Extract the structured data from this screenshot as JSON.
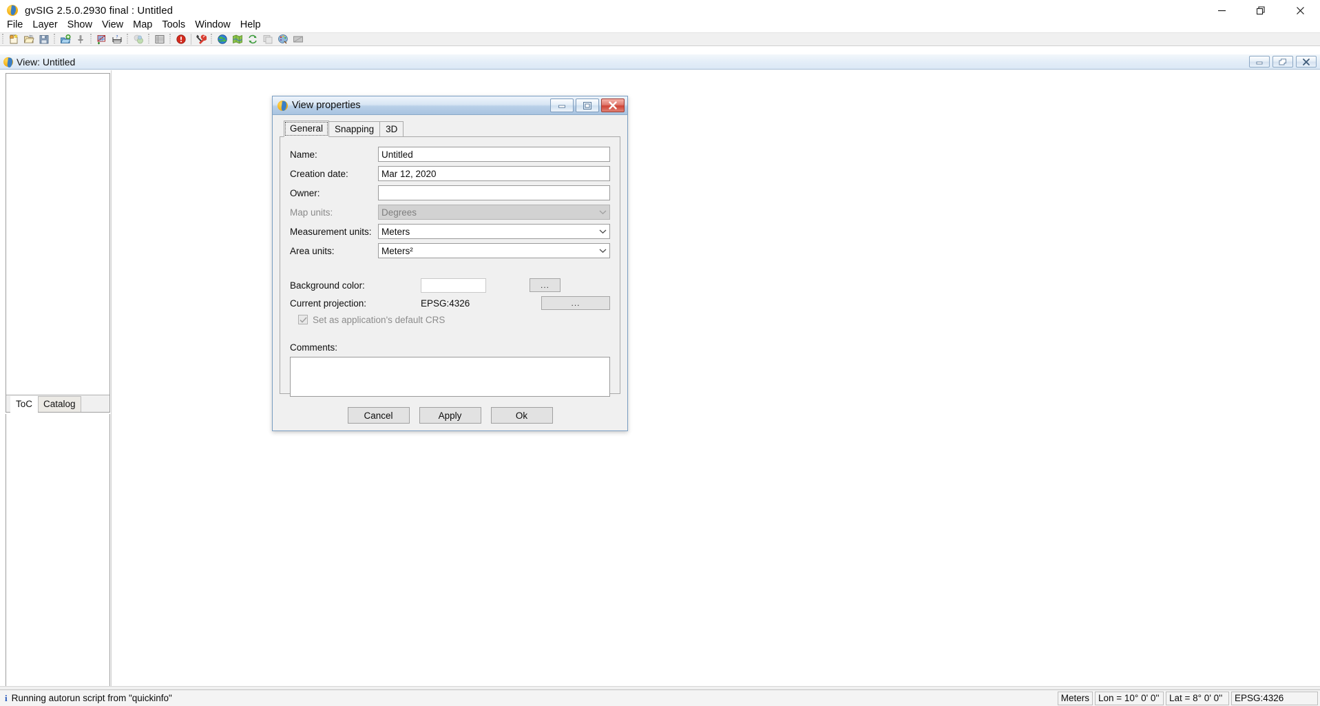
{
  "app": {
    "title": "gvSIG 2.5.0.2930 final : Untitled",
    "icon": "gvsig-logo-icon",
    "window_controls": {
      "minimize": "minimize-icon",
      "restore": "restore-icon",
      "close": "close-icon"
    }
  },
  "menubar": {
    "items": [
      {
        "label": "File"
      },
      {
        "label": "Layer"
      },
      {
        "label": "Show"
      },
      {
        "label": "View"
      },
      {
        "label": "Map"
      },
      {
        "label": "Tools"
      },
      {
        "label": "Window"
      },
      {
        "label": "Help"
      }
    ]
  },
  "toolbar": {
    "groups": [
      {
        "buttons": [
          {
            "name": "new-project-icon",
            "tip": "New project"
          },
          {
            "name": "open-project-icon",
            "tip": "Open project"
          },
          {
            "name": "save-project-icon",
            "tip": "Save project"
          }
        ]
      },
      {
        "buttons": [
          {
            "name": "add-layer-icon",
            "tip": "Add layer"
          },
          {
            "name": "pushpin-icon",
            "tip": "Locator"
          }
        ]
      },
      {
        "buttons": [
          {
            "name": "new-vector-layer-icon",
            "tip": "New vector layer"
          },
          {
            "name": "measure-icon",
            "tip": "Measure"
          }
        ]
      },
      {
        "buttons": [
          {
            "name": "geoprocess-icon",
            "tip": "Geoprocessing"
          }
        ]
      },
      {
        "buttons": [
          {
            "name": "attribute-table-icon",
            "tip": "Attribute table"
          }
        ]
      },
      {
        "buttons": [
          {
            "name": "alert-icon",
            "tip": "Error console"
          },
          {
            "name": "tools-icon",
            "tip": "Tools"
          }
        ]
      },
      {
        "buttons": [
          {
            "name": "globe-icon",
            "tip": "View"
          },
          {
            "name": "map-icon",
            "tip": "Map"
          },
          {
            "name": "refresh-icon",
            "tip": "Refresh"
          },
          {
            "name": "layout-icon",
            "tip": "Layout"
          },
          {
            "name": "palette-icon",
            "tip": "Symbology"
          },
          {
            "name": "screen-icon",
            "tip": "Full extent"
          }
        ]
      }
    ]
  },
  "view_window": {
    "title": "View: Untitled",
    "icon": "gvsig-logo-icon",
    "controls": {
      "minimize": "minimize-icon",
      "restore": "restore-icon",
      "close": "close-icon"
    },
    "panel_tabs": [
      {
        "label": "ToC",
        "active": true
      },
      {
        "label": "Catalog",
        "active": false
      }
    ]
  },
  "dialog": {
    "title": "View properties",
    "icon": "gvsig-logo-icon",
    "controls": {
      "minimize": "minimize-icon",
      "maximize": "maximize-icon",
      "close": "close-icon"
    },
    "tabs": [
      {
        "label": "General",
        "active": true
      },
      {
        "label": "Snapping",
        "active": false
      },
      {
        "label": "3D",
        "active": false
      }
    ],
    "fields": {
      "name_label": "Name:",
      "name_value": "Untitled",
      "creation_date_label": "Creation date:",
      "creation_date_value": "Mar 12, 2020",
      "owner_label": "Owner:",
      "owner_value": "",
      "owner_placeholder": "",
      "map_units_label": "Map units:",
      "map_units_value": "Degrees",
      "measurement_units_label": "Measurement units:",
      "measurement_units_value": "Meters",
      "area_units_label": "Area units:",
      "area_units_value": "Meters²",
      "background_color_label": "Background color:",
      "background_color_value": "#ffffff",
      "background_color_button": "...",
      "current_projection_label": "Current projection:",
      "current_projection_value": "EPSG:4326",
      "current_projection_button": "...",
      "default_crs_label": "Set as application's default CRS",
      "default_crs_checked": true,
      "comments_label": "Comments:",
      "comments_value": ""
    },
    "buttons": {
      "cancel": "Cancel",
      "apply": "Apply",
      "ok": "Ok"
    }
  },
  "statusbar": {
    "message": "Running autorun script from \"quickinfo\"",
    "info_icon": "info-icon",
    "cells": [
      {
        "name": "units-cell",
        "value": "Meters"
      },
      {
        "name": "longitude-cell",
        "value": "Lon = 10° 0' 0''"
      },
      {
        "name": "latitude-cell",
        "value": "Lat = 8° 0' 0''"
      },
      {
        "name": "projection-cell",
        "value": "EPSG:4326"
      }
    ]
  },
  "colors": {
    "title_gradient_start": "#eef4fb",
    "title_gradient_end": "#a8c3e0",
    "dialog_bg": "#f0f0f0",
    "close_red": "#cf4336",
    "accent_blue": "#3b7fc4",
    "logo_yellow": "#f5b41a"
  }
}
